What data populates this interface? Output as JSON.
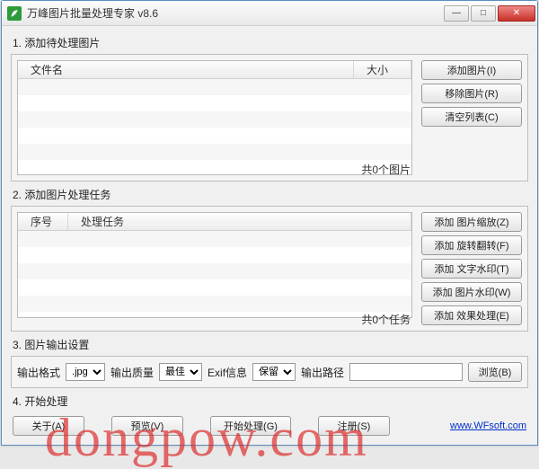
{
  "title": "万峰图片批量处理专家 v8.6",
  "winbtns": {
    "min": "—",
    "max": "□",
    "close": "✕"
  },
  "section1": {
    "label": "1. 添加待处理图片",
    "cols": {
      "filename": "文件名",
      "size": "大小"
    },
    "buttons": {
      "add": "添加图片(I)",
      "remove": "移除图片(R)",
      "clear": "清空列表(C)"
    },
    "count": "共0个图片"
  },
  "section2": {
    "label": "2. 添加图片处理任务",
    "cols": {
      "seq": "序号",
      "task": "处理任务"
    },
    "buttons": {
      "zoom": "添加 图片缩放(Z)",
      "rotate": "添加 旋转翻转(F)",
      "textwm": "添加 文字水印(T)",
      "imgwm": "添加 图片水印(W)",
      "effect": "添加 效果处理(E)"
    },
    "count": "共0个任务"
  },
  "section3": {
    "label": "3. 图片输出设置",
    "format_label": "输出格式",
    "format_value": ".jpg",
    "quality_label": "输出质量",
    "quality_value": "最佳",
    "exif_label": "Exif信息",
    "exif_value": "保留",
    "path_label": "输出路径",
    "path_value": "",
    "browse": "浏览(B)"
  },
  "section4": {
    "label": "4. 开始处理",
    "about": "关于(A)",
    "preview": "预览(V)",
    "start": "开始处理(G)",
    "register": "注册(S)",
    "link": "www.WFsoft.com"
  },
  "watermark": "dongpow.com"
}
